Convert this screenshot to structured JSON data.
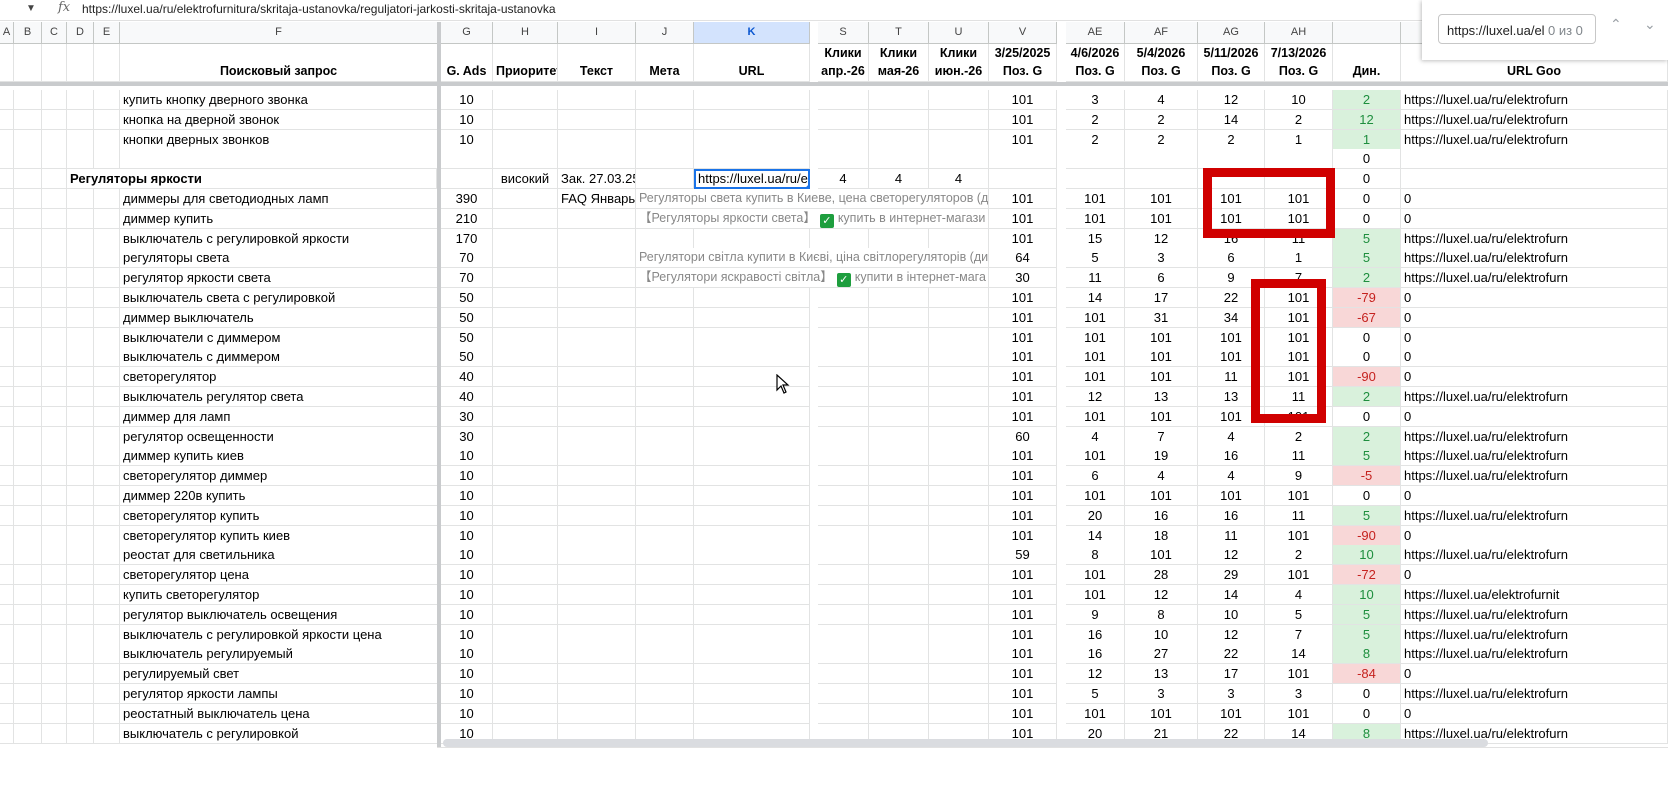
{
  "formula_bar": {
    "fx": "fx",
    "content": "https://luxel.ua/ru/elektrofurnitura/skritaja-ustanovka/reguljatori-jarkosti-skritaja-ustanovka"
  },
  "find": {
    "query": "https://luxel.ua/el",
    "count": "0 из 0",
    "up": "⌃",
    "down": "⌄"
  },
  "columns": [
    "A",
    "B",
    "C",
    "D",
    "E",
    "F",
    "G",
    "H",
    "I",
    "J",
    "K",
    "S",
    "T",
    "U",
    "V",
    "AE",
    "AF",
    "AG",
    "AH",
    "",
    ""
  ],
  "header_top": {
    "S": "Клики",
    "T": "Клики",
    "U": "Клики",
    "V": "3/25/2025",
    "AE": "4/6/2026",
    "AF": "5/4/2026",
    "AG": "5/11/2026",
    "AH": "7/13/2026"
  },
  "header_bottom": {
    "F": "Поисковый запрос",
    "G": "G. Ads",
    "H": "Приоритет",
    "I": "Текст",
    "J": "Мета",
    "K": "URL",
    "S": "апр.-26",
    "T": "мая-26",
    "U": "июн.-26",
    "V": "Поз. G",
    "AE": "Поз. G",
    "AF": "Поз. G",
    "AG": "Поз. G",
    "AH": "Поз. G",
    "DYN": "Дин.",
    "URLG": "URL Goo"
  },
  "rows": [
    {
      "q": "купить кнопку дверного звонка",
      "g": "10",
      "v": "101",
      "ae": "3",
      "af": "4",
      "ag": "12",
      "ah": "10",
      "dyn": "2",
      "dc": "pos",
      "url": "https://luxel.ua/ru/elektrofurn"
    },
    {
      "q": "кнопка на дверной звонок",
      "g": "10",
      "v": "101",
      "ae": "2",
      "af": "2",
      "ag": "14",
      "ah": "2",
      "dyn": "12",
      "dc": "pos",
      "url": "https://luxel.ua/ru/elektrofurn"
    },
    {
      "q": "кнопки дверных звонков",
      "g": "10",
      "v": "101",
      "ae": "2",
      "af": "2",
      "ag": "2",
      "ah": "1",
      "dyn": "1",
      "dc": "pos",
      "url": "https://luxel.ua/ru/elektrofurn"
    },
    {
      "q": "",
      "g": "",
      "v": "",
      "ae": "",
      "af": "",
      "ag": "",
      "ah": "",
      "dyn": "0",
      "dc": "",
      "url": ""
    },
    {
      "group": "Регуляторы яркости",
      "h": "високий",
      "i": "Зак. 27.03.25",
      "k": "https://luxel.ua/ru/el",
      "s": "4",
      "t": "4",
      "u": "4",
      "q": "",
      "g": "",
      "v": "",
      "ae": "",
      "af": "",
      "ag": "",
      "ah": "",
      "dyn": "0",
      "dc": "",
      "url": ""
    },
    {
      "q": "диммеры для светодиодных ламп",
      "g": "390",
      "i": "FAQ Январь",
      "j": "Регуляторы света купить в Киеве, цена светорегуляторов (ди",
      "v": "101",
      "ae": "101",
      "af": "101",
      "ag": "101",
      "ah": "101",
      "dyn": "0",
      "dc": "",
      "url": "0"
    },
    {
      "q": "диммер купить",
      "g": "210",
      "j": "【Регуляторы яркости света】",
      "jcheck": "✓",
      "j2": "купить в интернет-магази",
      "v": "101",
      "ae": "101",
      "af": "101",
      "ag": "101",
      "ah": "101",
      "dyn": "0",
      "dc": "",
      "url": "0"
    },
    {
      "q": "выключатель с регулировкой яркости",
      "g": "170",
      "v": "101",
      "ae": "15",
      "af": "12",
      "ag": "16",
      "ah": "11",
      "dyn": "5",
      "dc": "pos",
      "url": "https://luxel.ua/ru/elektrofurn"
    },
    {
      "q": "регуляторы света",
      "g": "70",
      "j": "Регулятори світла купити в Києві, ціна світлорегуляторів (ди",
      "v": "64",
      "ae": "5",
      "af": "3",
      "ag": "6",
      "ah": "1",
      "dyn": "5",
      "dc": "pos",
      "url": "https://luxel.ua/ru/elektrofurn"
    },
    {
      "q": "регулятор яркости света",
      "g": "70",
      "j": "【Регулятори яскравості світла】",
      "jcheck": "✓",
      "j2": "купити в інтернет-мага",
      "v": "30",
      "ae": "11",
      "af": "6",
      "ag": "9",
      "ah": "7",
      "dyn": "2",
      "dc": "pos",
      "url": "https://luxel.ua/ru/elektrofurn"
    },
    {
      "q": "выключатель света с регулировкой",
      "g": "50",
      "v": "101",
      "ae": "14",
      "af": "17",
      "ag": "22",
      "ah": "101",
      "dyn": "-79",
      "dc": "neg",
      "url": "0"
    },
    {
      "q": "диммер выключатель",
      "g": "50",
      "v": "101",
      "ae": "101",
      "af": "31",
      "ag": "34",
      "ah": "101",
      "dyn": "-67",
      "dc": "neg",
      "url": "0"
    },
    {
      "q": "выключатели с диммером",
      "g": "50",
      "v": "101",
      "ae": "101",
      "af": "101",
      "ag": "101",
      "ah": "101",
      "dyn": "0",
      "dc": "",
      "url": "0"
    },
    {
      "q": "выключатель с диммером",
      "g": "50",
      "v": "101",
      "ae": "101",
      "af": "101",
      "ag": "101",
      "ah": "101",
      "dyn": "0",
      "dc": "",
      "url": "0"
    },
    {
      "q": "светорегулятор",
      "g": "40",
      "v": "101",
      "ae": "101",
      "af": "101",
      "ag": "11",
      "ah": "101",
      "dyn": "-90",
      "dc": "neg",
      "url": "0"
    },
    {
      "q": "выключатель регулятор света",
      "g": "40",
      "v": "101",
      "ae": "12",
      "af": "13",
      "ag": "13",
      "ah": "11",
      "dyn": "2",
      "dc": "pos",
      "url": "https://luxel.ua/ru/elektrofurn"
    },
    {
      "q": "диммер для ламп",
      "g": "30",
      "v": "101",
      "ae": "101",
      "af": "101",
      "ag": "101",
      "ah": "101",
      "dyn": "0",
      "dc": "",
      "url": "0"
    },
    {
      "q": "регулятор освещенности",
      "g": "30",
      "v": "60",
      "ae": "4",
      "af": "7",
      "ag": "4",
      "ah": "2",
      "dyn": "2",
      "dc": "pos",
      "url": "https://luxel.ua/ru/elektrofurn"
    },
    {
      "q": "диммер купить киев",
      "g": "10",
      "v": "101",
      "ae": "101",
      "af": "19",
      "ag": "16",
      "ah": "11",
      "dyn": "5",
      "dc": "pos",
      "url": "https://luxel.ua/ru/elektrofurn"
    },
    {
      "q": "светорегулятор диммер",
      "g": "10",
      "v": "101",
      "ae": "6",
      "af": "4",
      "ag": "4",
      "ah": "9",
      "dyn": "-5",
      "dc": "neg",
      "url": "https://luxel.ua/ru/elektrofurn"
    },
    {
      "q": "диммер 220в купить",
      "g": "10",
      "v": "101",
      "ae": "101",
      "af": "101",
      "ag": "101",
      "ah": "101",
      "dyn": "0",
      "dc": "",
      "url": "0"
    },
    {
      "q": "светорегулятор купить",
      "g": "10",
      "v": "101",
      "ae": "20",
      "af": "16",
      "ag": "16",
      "ah": "11",
      "dyn": "5",
      "dc": "pos",
      "url": "https://luxel.ua/ru/elektrofurn"
    },
    {
      "q": "светорегулятор купить киев",
      "g": "10",
      "v": "101",
      "ae": "14",
      "af": "18",
      "ag": "11",
      "ah": "101",
      "dyn": "-90",
      "dc": "neg",
      "url": "0"
    },
    {
      "q": "реостат для светильника",
      "g": "10",
      "v": "59",
      "ae": "8",
      "af": "101",
      "ag": "12",
      "ah": "2",
      "dyn": "10",
      "dc": "pos",
      "url": "https://luxel.ua/ru/elektrofurn"
    },
    {
      "q": "светорегулятор цена",
      "g": "10",
      "v": "101",
      "ae": "101",
      "af": "28",
      "ag": "29",
      "ah": "101",
      "dyn": "-72",
      "dc": "neg",
      "url": "0"
    },
    {
      "q": "купить светорегулятор",
      "g": "10",
      "v": "101",
      "ae": "101",
      "af": "12",
      "ag": "14",
      "ah": "4",
      "dyn": "10",
      "dc": "pos",
      "url": "https://luxel.ua/elektrofurnit"
    },
    {
      "q": "регулятор выключатель освещения",
      "g": "10",
      "v": "101",
      "ae": "9",
      "af": "8",
      "ag": "10",
      "ah": "5",
      "dyn": "5",
      "dc": "pos",
      "url": "https://luxel.ua/ru/elektrofurn"
    },
    {
      "q": "выключатель с регулировкой яркости цена",
      "g": "10",
      "v": "101",
      "ae": "16",
      "af": "10",
      "ag": "12",
      "ah": "7",
      "dyn": "5",
      "dc": "pos",
      "url": "https://luxel.ua/ru/elektrofurn"
    },
    {
      "q": "выключатель регулируемый",
      "g": "10",
      "v": "101",
      "ae": "16",
      "af": "27",
      "ag": "22",
      "ah": "14",
      "dyn": "8",
      "dc": "pos",
      "url": "https://luxel.ua/ru/elektrofurn"
    },
    {
      "q": "регулируемый свет",
      "g": "10",
      "v": "101",
      "ae": "12",
      "af": "13",
      "ag": "17",
      "ah": "101",
      "dyn": "-84",
      "dc": "neg",
      "url": "0"
    },
    {
      "q": "регулятор яркости лампы",
      "g": "10",
      "v": "101",
      "ae": "5",
      "af": "3",
      "ag": "3",
      "ah": "3",
      "dyn": "0",
      "dc": "",
      "url": "https://luxel.ua/ru/elektrofurn"
    },
    {
      "q": "реостатный выключатель цена",
      "g": "10",
      "v": "101",
      "ae": "101",
      "af": "101",
      "ag": "101",
      "ah": "101",
      "dyn": "0",
      "dc": "",
      "url": "0"
    },
    {
      "q": "выключатель с регулировкой",
      "g": "10",
      "v": "101",
      "ae": "20",
      "af": "21",
      "ag": "22",
      "ah": "14",
      "dyn": "8",
      "dc": "pos",
      "url": "https://luxel.ua/ru/elektrofurn"
    }
  ]
}
